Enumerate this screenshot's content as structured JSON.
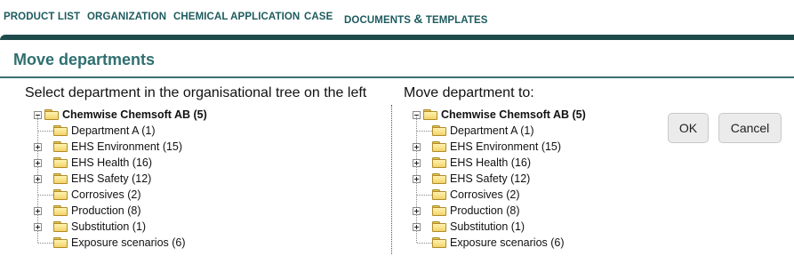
{
  "nav": {
    "items": [
      {
        "label": "PRODUCT LIST"
      },
      {
        "label": "ORGANIZATION"
      },
      {
        "label": "CHEMICAL APPLICATION"
      },
      {
        "label": "CASE"
      },
      {
        "label_pre": "DOCUMENTS ",
        "label_amp": "&",
        "label_post": " TEMPLATES"
      }
    ]
  },
  "page": {
    "title": "Move departments"
  },
  "left_panel": {
    "heading": "Select department in the organisational tree on the left",
    "root": "Chemwise Chemsoft AB (5)",
    "children": [
      {
        "label": "Department A (1)",
        "expandable": false
      },
      {
        "label": "EHS Environment (15)",
        "expandable": true
      },
      {
        "label": "EHS Health (16)",
        "expandable": true
      },
      {
        "label": "EHS Safety (12)",
        "expandable": true
      },
      {
        "label": "Corrosives (2)",
        "expandable": false
      },
      {
        "label": "Production (8)",
        "expandable": true
      },
      {
        "label": "Substitution (1)",
        "expandable": true
      },
      {
        "label": "Exposure scenarios (6)",
        "expandable": false
      }
    ]
  },
  "right_panel": {
    "heading": "Move department to:",
    "root": "Chemwise Chemsoft AB (5)",
    "children": [
      {
        "label": "Department A (1)",
        "expandable": false
      },
      {
        "label": "EHS Environment (15)",
        "expandable": true
      },
      {
        "label": "EHS Health (16)",
        "expandable": true
      },
      {
        "label": "EHS Safety (12)",
        "expandable": true
      },
      {
        "label": "Corrosives (2)",
        "expandable": false
      },
      {
        "label": "Production (8)",
        "expandable": true
      },
      {
        "label": "Substitution (1)",
        "expandable": true
      },
      {
        "label": "Exposure scenarios (6)",
        "expandable": false
      }
    ]
  },
  "buttons": {
    "ok": "OK",
    "cancel": "Cancel"
  },
  "colors": {
    "nav_text": "#1d5b5e",
    "band": "#1f4a4c",
    "title": "#2f6f70",
    "folder": "#f2d36a"
  },
  "icons": {
    "folder": "folder-icon",
    "expand": "expand-plus-icon",
    "collapse": "collapse-minus-icon"
  }
}
